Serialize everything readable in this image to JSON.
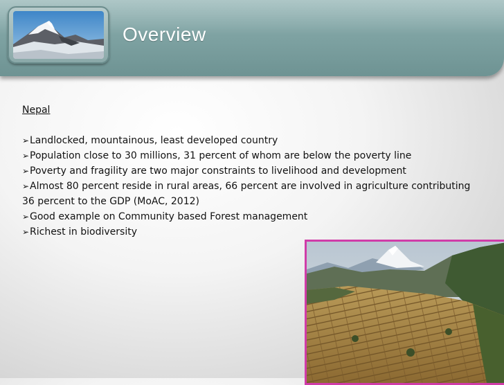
{
  "slide": {
    "title": "Overview",
    "heading": "Nepal",
    "bullets": [
      "Landlocked, mountainous, least developed country",
      "Population close to 30 millions, 31 percent of whom are below the poverty line",
      "Poverty and fragility are two major constraints to livelihood and development",
      "Almost 80 percent reside in rural areas, 66 percent are involved in agriculture contributing 36 percent to the GDP (MoAC, 2012)",
      "Good example on Community based Forest management",
      "Richest in biodiversity"
    ],
    "bullet_marker": "➢"
  },
  "colors": {
    "header": "#7fa3a3",
    "photo_border": "#d03ca8",
    "text": "#111111"
  },
  "images": {
    "header_photo": "snow-mountain-photo",
    "valley_photo": "terraced-valley-photo"
  }
}
